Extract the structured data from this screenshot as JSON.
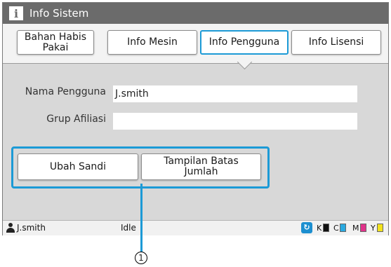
{
  "window": {
    "title": "Info Sistem",
    "title_icon": "info-icon"
  },
  "tabs": [
    {
      "label": "Bahan Habis\nPakai"
    },
    {
      "label": "Info Mesin"
    },
    {
      "label": "Info Pengguna",
      "active": true
    },
    {
      "label": "Info Lisensi"
    }
  ],
  "form": {
    "user_name_label": "Nama Pengguna",
    "user_name_value": "J.smith",
    "group_label": "Grup Afiliasi",
    "group_value": ""
  },
  "actions": {
    "change_password": "Ubah Sandi",
    "show_limit": "Tampilan Batas\nJumlah"
  },
  "status": {
    "user": "J.smith",
    "state": "Idle",
    "network_icon": "network-icon",
    "inks": [
      {
        "label": "K",
        "color": "#111111"
      },
      {
        "label": "C",
        "color": "#29a9e0"
      },
      {
        "label": "M",
        "color": "#e0328a"
      },
      {
        "label": "Y",
        "color": "#f2e21c"
      }
    ]
  },
  "annotation": {
    "callout": "1"
  },
  "colors": {
    "accent": "#1c9ad6",
    "titlebar": "#6b6b6b"
  }
}
